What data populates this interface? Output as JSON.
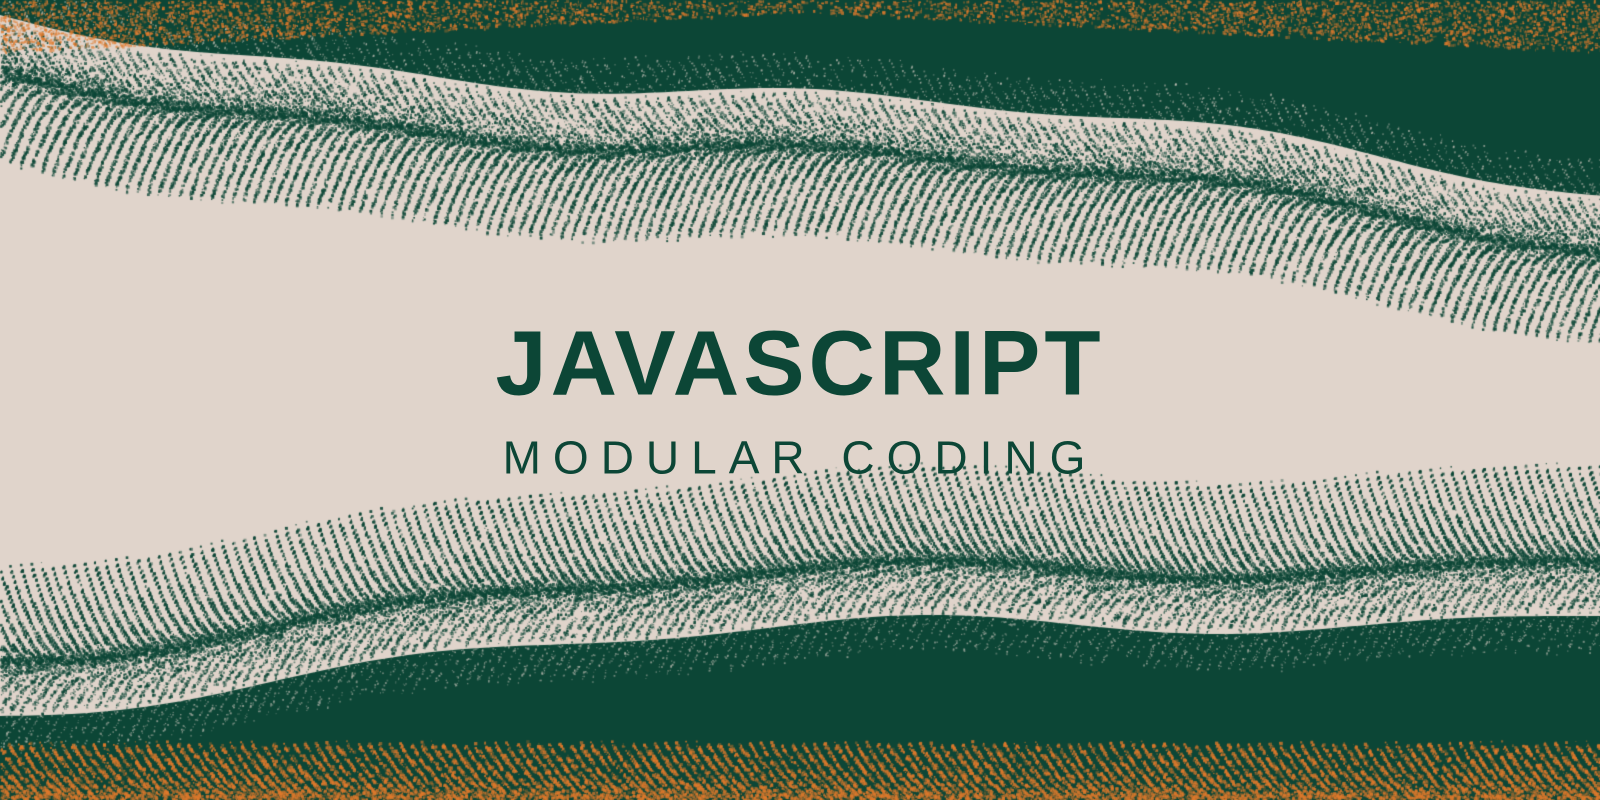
{
  "banner": {
    "title": "JAVASCRIPT",
    "subtitle": "MODULAR CODING"
  },
  "colors": {
    "background": "#e0d4cb",
    "dark_green": "#0c4636",
    "orange": "#e07a2c",
    "text": "#0c4636"
  }
}
